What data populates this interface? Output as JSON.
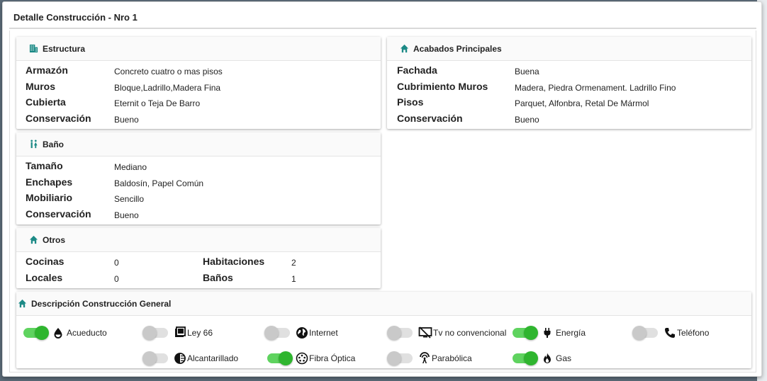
{
  "modal": {
    "title": "Detalle Construcción - Nro 1"
  },
  "estructura": {
    "title": "Estructura",
    "icon": "building-icon",
    "rows": [
      {
        "label": "Armazón",
        "value": "Concreto cuatro o mas pisos"
      },
      {
        "label": "Muros",
        "value": "Bloque,Ladrillo,Madera Fina"
      },
      {
        "label": "Cubierta",
        "value": "Eternit o Teja De Barro"
      },
      {
        "label": "Conservación",
        "value": "Bueno"
      }
    ]
  },
  "acabados": {
    "title": "Acabados Principales",
    "icon": "home-icon",
    "rows": [
      {
        "label": "Fachada",
        "value": "Buena"
      },
      {
        "label": "Cubrimiento Muros",
        "value": "Madera, Piedra Ormenament. Ladrillo Fino"
      },
      {
        "label": "Pisos",
        "value": "Parquet, Alfonbra, Retal De Mármol"
      },
      {
        "label": "Conservación",
        "value": "Bueno"
      }
    ]
  },
  "bano": {
    "title": "Baño",
    "icon": "restroom-icon",
    "rows": [
      {
        "label": "Tamaño",
        "value": "Mediano"
      },
      {
        "label": "Enchapes",
        "value": "Baldosín, Papel Común"
      },
      {
        "label": "Mobiliario",
        "value": "Sencillo"
      },
      {
        "label": "Conservación",
        "value": "Bueno"
      }
    ]
  },
  "otros": {
    "title": "Otros",
    "icon": "home-icon",
    "items": [
      {
        "label": "Cocinas",
        "value": "0"
      },
      {
        "label": "Habitaciones",
        "value": "2"
      },
      {
        "label": "Locales",
        "value": "0"
      },
      {
        "label": "Baños",
        "value": "1"
      }
    ]
  },
  "general": {
    "title": "Descripción Construcción General",
    "icon": "home-icon",
    "services": [
      {
        "label": "Acueducto",
        "on": true,
        "icon": "water-drop-icon"
      },
      {
        "label": "Ley 66",
        "on": false,
        "icon": "ley66-icon"
      },
      {
        "label": "Internet",
        "on": false,
        "icon": "globe-icon"
      },
      {
        "label": "Tv no convencional",
        "on": false,
        "icon": "tv-off-icon"
      },
      {
        "label": "Energía",
        "on": true,
        "icon": "plug-icon"
      },
      {
        "label": "Teléfono",
        "on": false,
        "icon": "phone-icon"
      },
      {
        "label": "Alcantarillado",
        "on": false,
        "icon": "sewer-icon"
      },
      {
        "label": "Fibra Óptica",
        "on": true,
        "icon": "fiber-icon"
      },
      {
        "label": "Parabólica",
        "on": false,
        "icon": "antenna-icon"
      },
      {
        "label": "Gas",
        "on": true,
        "icon": "flame-icon"
      }
    ]
  },
  "colors": {
    "accent": "#1c8a86",
    "toggle_on": "#2fb52f",
    "toggle_off": "#c9c9c9"
  }
}
